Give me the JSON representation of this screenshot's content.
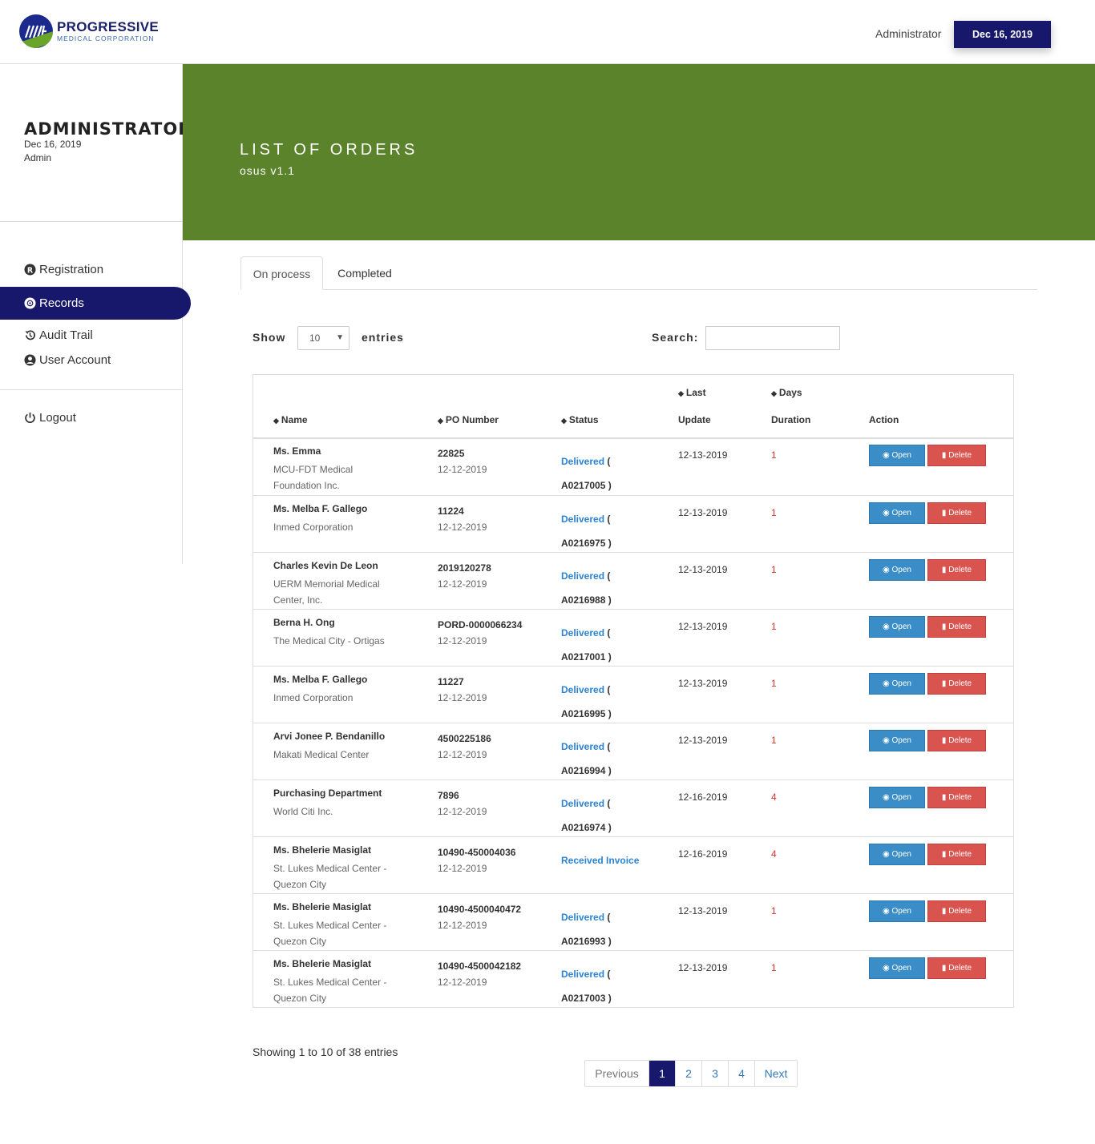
{
  "brand": {
    "name": "PROGRESSIVE",
    "tagline": "MEDICAL CORPORATION",
    "primary_color": "#17176b",
    "accent_color": "#5b832c"
  },
  "topbar": {
    "user": "Administrator",
    "date": "Dec 16, 2019"
  },
  "sidebar": {
    "title": "ADMINISTRATOR",
    "date": "Dec 16, 2019",
    "role": "Admin",
    "items": [
      {
        "label": "Registration",
        "icon": "registered-icon"
      },
      {
        "label": "Records",
        "icon": "disc-icon",
        "active": true
      },
      {
        "label": "Audit Trail",
        "icon": "history-icon"
      },
      {
        "label": "User Account",
        "icon": "user-circle-icon"
      }
    ],
    "logout": "Logout"
  },
  "banner": {
    "title": "LIST OF ORDERS",
    "subtitle": "osus v1.1"
  },
  "tabs": [
    {
      "label": "On process",
      "active": true
    },
    {
      "label": "Completed"
    }
  ],
  "controls": {
    "show": "Show",
    "entries_value": "10",
    "entries": "entries",
    "search": "Search:",
    "search_value": ""
  },
  "table": {
    "headers": {
      "name": "Name",
      "po": "PO Number",
      "status": "Status",
      "last1": "Last",
      "last2": "Update",
      "days1": "Days",
      "days2": "Duration",
      "action": "Action"
    },
    "open_label": "Open",
    "delete_label": "Delete",
    "rows": [
      {
        "name": "Ms. Emma",
        "org": "MCU-FDT Medical Foundation Inc.",
        "po": "22825",
        "po_date": "12-12-2019",
        "status": "Delivered",
        "ref": "( A0217005 )",
        "updated": "12-13-2019",
        "days": "1"
      },
      {
        "name": "Ms. Melba F. Gallego",
        "org": "Inmed Corporation",
        "po": "11224",
        "po_date": "12-12-2019",
        "status": "Delivered",
        "ref": "( A0216975 )",
        "updated": "12-13-2019",
        "days": "1"
      },
      {
        "name": "Charles Kevin De Leon",
        "org": "UERM Memorial Medical Center, Inc.",
        "po": "2019120278",
        "po_date": "12-12-2019",
        "status": "Delivered",
        "ref": "( A0216988 )",
        "updated": "12-13-2019",
        "days": "1"
      },
      {
        "name": "Berna H. Ong",
        "org": "The Medical City - Ortigas",
        "po": "PORD-0000066234",
        "po_date": "12-12-2019",
        "status": "Delivered",
        "ref": "( A0217001 )",
        "updated": "12-13-2019",
        "days": "1"
      },
      {
        "name": "Ms. Melba F. Gallego",
        "org": "Inmed Corporation",
        "po": "11227",
        "po_date": "12-12-2019",
        "status": "Delivered",
        "ref": "( A0216995 )",
        "updated": "12-13-2019",
        "days": "1"
      },
      {
        "name": "Arvi Jonee P. Bendanillo",
        "org": "Makati Medical Center",
        "po": "4500225186",
        "po_date": "12-12-2019",
        "status": "Delivered",
        "ref": "( A0216994 )",
        "updated": "12-13-2019",
        "days": "1"
      },
      {
        "name": "Purchasing Department",
        "org": "World Citi Inc.",
        "po": "7896",
        "po_date": "12-12-2019",
        "status": "Delivered",
        "ref": "( A0216974 )",
        "updated": "12-16-2019",
        "days": "4"
      },
      {
        "name": "Ms. Bhelerie Masiglat",
        "org": "St. Lukes Medical Center - Quezon City",
        "po": "10490-450004036",
        "po_date": "12-12-2019",
        "status": "Received Invoice",
        "ref": "",
        "updated": "12-16-2019",
        "days": "4"
      },
      {
        "name": "Ms. Bhelerie Masiglat",
        "org": "St. Lukes Medical Center - Quezon City",
        "po": "10490-4500040472",
        "po_date": "12-12-2019",
        "status": "Delivered",
        "ref": "( A0216993 )",
        "updated": "12-13-2019",
        "days": "1"
      },
      {
        "name": "Ms. Bhelerie Masiglat",
        "org": "St. Lukes Medical Center - Quezon City",
        "po": "10490-4500042182",
        "po_date": "12-12-2019",
        "status": "Delivered",
        "ref": "( A0217003 )",
        "updated": "12-13-2019",
        "days": "1"
      }
    ]
  },
  "footer": {
    "showing": "Showing 1 to 10 of 38 entries"
  },
  "pagination": {
    "previous": "Previous",
    "pages": [
      "1",
      "2",
      "3",
      "4"
    ],
    "current": "1",
    "next": "Next"
  }
}
